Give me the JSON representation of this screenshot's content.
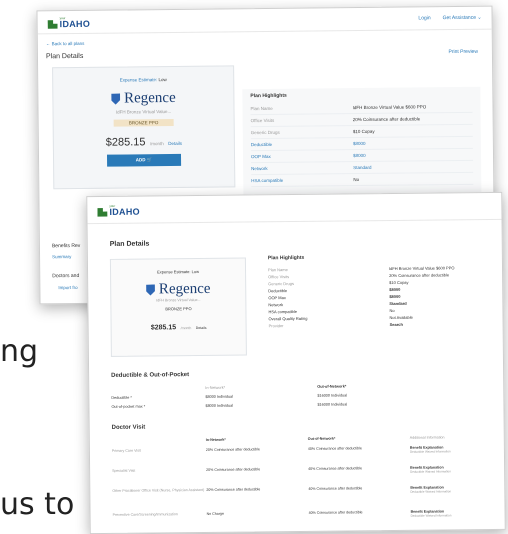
{
  "background": {
    "line1_fragment": "ng",
    "line2_fragment": "us to"
  },
  "header": {
    "logo_small": "your",
    "logo_text": "IDAHO",
    "login": "Login",
    "get_assistance": "Get Assistance ⌄"
  },
  "back": {
    "back_link": "← Back to all plans",
    "print_preview": "Print Preview"
  },
  "plan": {
    "title": "Plan Details",
    "expense_estimate_label": "Expense Estimate:",
    "expense_estimate_value": "Low",
    "carrier": "Regence",
    "plan_subtitle": "IdFH Bronze Virtual Value...",
    "metal": "BRONZE",
    "type": "PPO",
    "price": "$285.15",
    "per_month": "/month",
    "details_link": "Details",
    "add_label": "ADD 🛒"
  },
  "highlights": {
    "title": "Plan Highlights",
    "rows": [
      {
        "label": "Plan Name",
        "value": "IdFH Bronze Virtual Value $600 PPO"
      },
      {
        "label": "Office Visits",
        "value": "20% Coinsurance after deductible"
      },
      {
        "label": "Generic Drugs",
        "value": "$10 Copay"
      },
      {
        "label": "Deductible",
        "value": "$8000"
      },
      {
        "label": "OOP Max",
        "value": "$8000"
      },
      {
        "label": "Network",
        "value": "Standard"
      },
      {
        "label": "HSA compatible",
        "value": "No"
      },
      {
        "label": "Overall Quality Rating",
        "value": "Not Available"
      },
      {
        "label": "Provider",
        "value": "Search"
      }
    ]
  },
  "back_screen": {
    "benefits_heading": "Benefits Rev",
    "summary_link": "Summary",
    "doctors_heading": "Doctors and",
    "import_link": "Import fro"
  },
  "deductible": {
    "title": "Deductible & Out-of-Pocket",
    "col_in": "In-Network*",
    "col_out": "Out-of-Network*",
    "rows": [
      {
        "label": "Deductible *",
        "in": "$8000 Individual",
        "out": "$16000 Individual"
      },
      {
        "label": "Out-of-pocket max *",
        "in": "$8000 Individual",
        "out": "$16000 Individual"
      }
    ]
  },
  "doctor_visit": {
    "title": "Doctor Visit",
    "col_in": "In-Network*",
    "col_out": "Out-of-Network*",
    "col_info": "Additional Information",
    "rows": [
      {
        "label": "Primary Care Visit",
        "in": "20% Coinsurance after deductible",
        "out": "40% Coinsurance after deductible",
        "info_title": "Benefit Explanation",
        "info_sub": "Deductible Waived Information"
      },
      {
        "label": "Specialist Visit",
        "in": "20% Coinsurance after deductible",
        "out": "40% Coinsurance after deductible",
        "info_title": "Benefit Explanation",
        "info_sub": "Deductible Waived Information"
      },
      {
        "label": "Other Practitioner Office Visit (Nurse, Physician Assistant)",
        "in": "20% Coinsurance after deductible",
        "out": "40% Coinsurance after deductible",
        "info_title": "Benefit Explanation",
        "info_sub": "Deductible Waived Information"
      },
      {
        "label": "Preventive Care/Screening/Immunization",
        "in": "No Charge",
        "out": "40% Coinsurance after deductible",
        "info_title": "Benefit Explanation",
        "info_sub": "Deductible Waived Information"
      }
    ]
  }
}
